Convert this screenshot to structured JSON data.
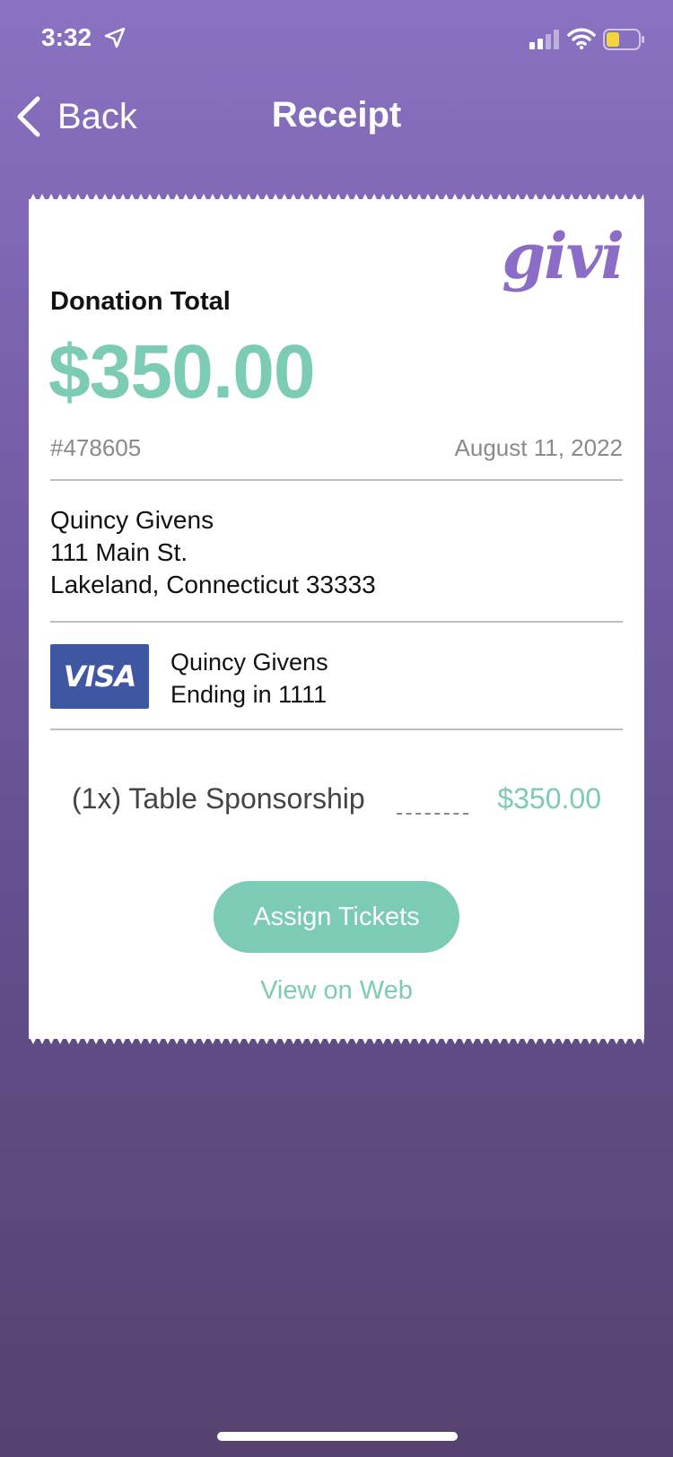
{
  "status_bar": {
    "time": "3:32"
  },
  "nav": {
    "back_label": "Back",
    "title": "Receipt"
  },
  "receipt": {
    "logo": "givi",
    "donation_label": "Donation Total",
    "donation_amount": "$350.00",
    "receipt_number": "#478605",
    "date": "August 11, 2022",
    "address": {
      "name": "Quincy Givens",
      "street": "111 Main St.",
      "city_state_zip": "Lakeland, Connecticut 33333"
    },
    "payment": {
      "card_brand": "VISA",
      "card_holder": "Quincy Givens",
      "card_ending": "Ending in 1111"
    },
    "line_item": {
      "label": "(1x) Table Sponsorship",
      "price": "$350.00"
    },
    "assign_tickets_label": "Assign Tickets",
    "view_on_web_label": "View on Web"
  },
  "colors": {
    "accent_teal": "#7ccbb5",
    "brand_purple": "#8b6dc8",
    "visa_blue": "#3f57a3"
  }
}
